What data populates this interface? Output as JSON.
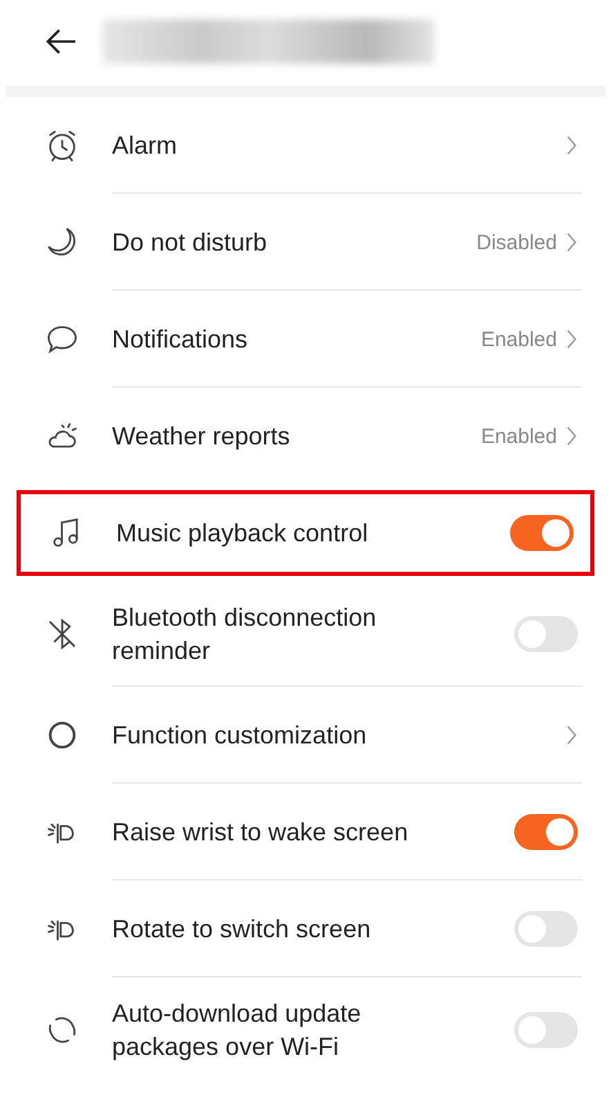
{
  "header": {
    "title_blurred": true
  },
  "items": [
    {
      "kind": "link",
      "label": "Alarm",
      "highlighted": false
    },
    {
      "kind": "link",
      "label": "Do not disturb",
      "value": "Disabled",
      "highlighted": false
    },
    {
      "kind": "link",
      "label": "Notifications",
      "value": "Enabled",
      "highlighted": false
    },
    {
      "kind": "link",
      "label": "Weather reports",
      "value": "Enabled",
      "highlighted": false
    },
    {
      "kind": "toggle",
      "label": "Music playback control",
      "on": true,
      "highlighted": true
    },
    {
      "kind": "toggle",
      "label": "Bluetooth disconnection reminder",
      "on": false,
      "highlighted": false
    },
    {
      "kind": "link",
      "label": "Function customization",
      "highlighted": false
    },
    {
      "kind": "toggle",
      "label": "Raise wrist to wake screen",
      "on": true,
      "highlighted": false
    },
    {
      "kind": "toggle",
      "label": "Rotate to switch screen",
      "on": false,
      "highlighted": false
    },
    {
      "kind": "toggle",
      "label": "Auto-download update packages over Wi-Fi",
      "on": false,
      "highlighted": false
    }
  ]
}
